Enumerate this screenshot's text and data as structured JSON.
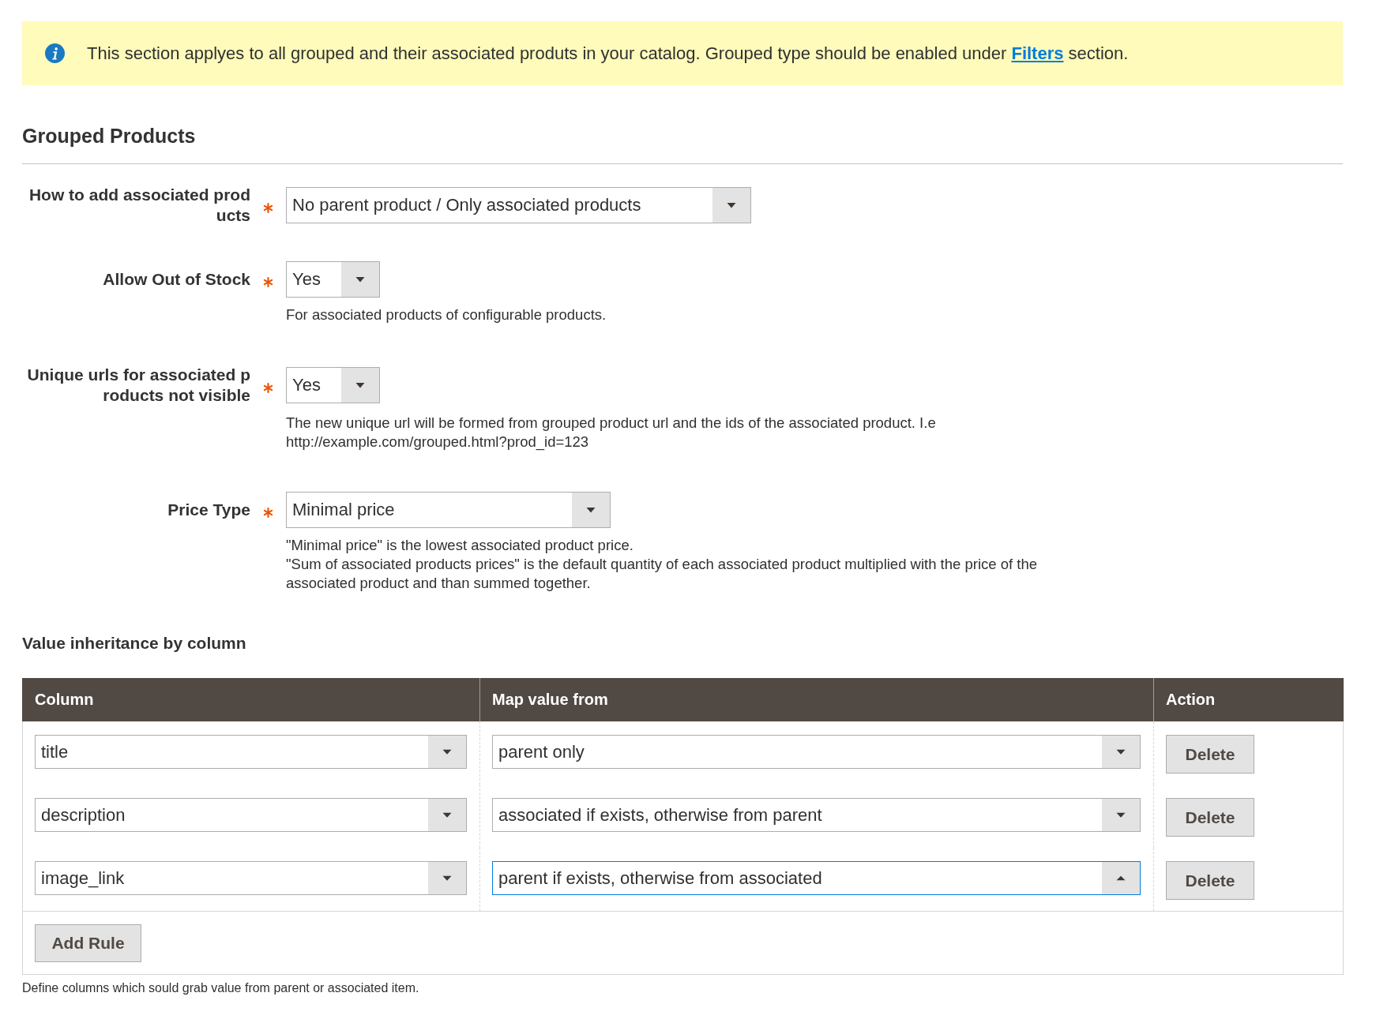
{
  "notice": {
    "text": "This section applyes to all grouped and their associated produts in your catalog. Grouped type should be enabled under",
    "link": "Filters",
    "text_after": "section."
  },
  "section_title": "Grouped Products",
  "fields": [
    {
      "label": "How to add associated products",
      "required": true,
      "value": "No parent product / Only associated products"
    },
    {
      "label": "Allow Out of Stock",
      "required": true,
      "value": "Yes",
      "notes": [
        "For associated products of configurable products."
      ]
    },
    {
      "label": "Unique urls for associated products not visible",
      "required": true,
      "value": "Yes",
      "notes": [
        "The new unique url will be formed from grouped product url and the ids of the associated product. I.e http://example.com/grouped.html?prod_id=123"
      ]
    },
    {
      "label": "Price Type",
      "required": true,
      "value": "Minimal price",
      "notes": [
        "\"Minimal price\" is the lowest associated product price.",
        "\"Sum of associated products prices\" is the default quantity of each associated product multiplied with the price of the associated product and than summed together."
      ]
    }
  ],
  "inheritance": {
    "title": "Value inheritance by column",
    "columns": [
      "Column",
      "Map value from",
      "Action"
    ],
    "rules": [
      {
        "column": {
          "value": "title",
          "expanded": false
        },
        "map_from": {
          "value": "parent only",
          "expanded": false
        },
        "action": "Delete"
      },
      {
        "column": {
          "value": "description",
          "expanded": false
        },
        "map_from": {
          "value": "associated if exists, otherwise from parent",
          "expanded": false
        },
        "action": "Delete"
      },
      {
        "column": {
          "value": "image_link",
          "expanded": false
        },
        "map_from": {
          "value": "parent if exists, otherwise from associated",
          "expanded": true
        },
        "action": "Delete"
      }
    ],
    "add_button": "Add Rule",
    "note": "Define columns which sould grab value from parent or associated item."
  }
}
